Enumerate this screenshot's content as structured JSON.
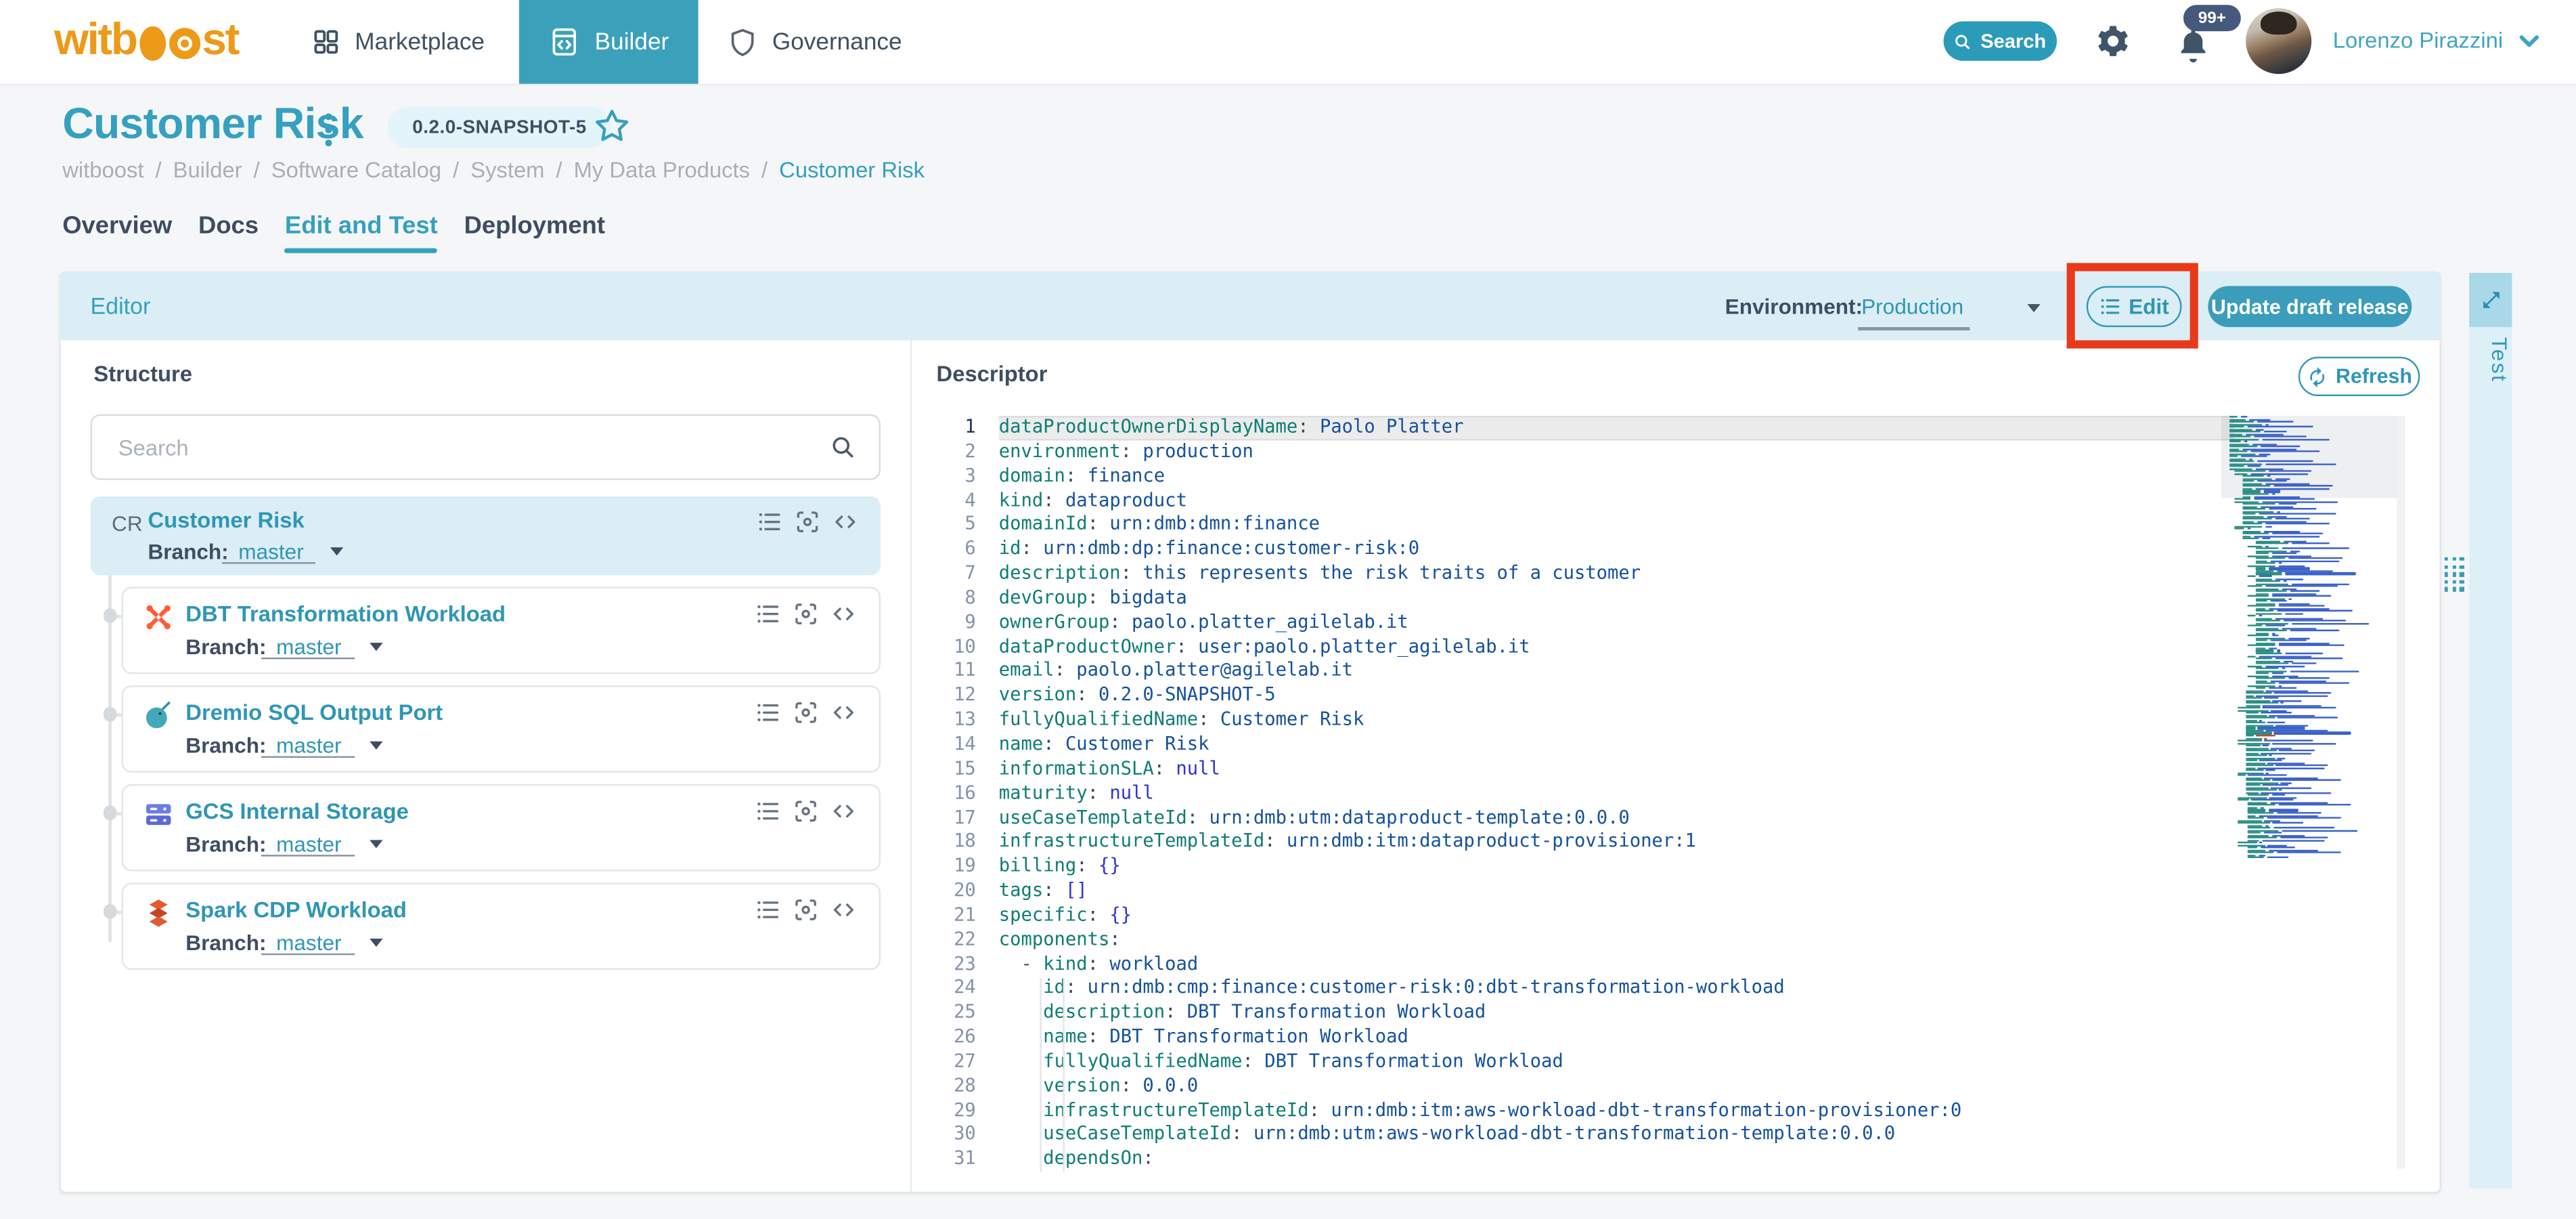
{
  "nav": {
    "logo_word_start": "witb",
    "logo_word_end": "st",
    "items": [
      {
        "label": "Marketplace"
      },
      {
        "label": "Builder"
      },
      {
        "label": "Governance"
      }
    ],
    "active_item": "Builder",
    "search_label": "Search",
    "notifications_badge": "99+",
    "user_name": "Lorenzo Pirazzini"
  },
  "page": {
    "title": "Customer Risk",
    "version_badge": "0.2.0-SNAPSHOT-5",
    "breadcrumb": [
      "witboost",
      "Builder",
      "Software Catalog",
      "System",
      "My Data Products",
      "Customer Risk"
    ],
    "tabs": [
      "Overview",
      "Docs",
      "Edit and Test",
      "Deployment"
    ],
    "active_tab": "Edit and Test"
  },
  "editor": {
    "title": "Editor",
    "environment_label": "Environment:",
    "environment_value": "Production",
    "edit_button": "Edit",
    "update_button": "Update draft release",
    "test_tab": "Test"
  },
  "structure": {
    "title": "Structure",
    "search_placeholder": "Search",
    "branch_label": "Branch:",
    "root": {
      "initials": "CR",
      "name": "Customer Risk",
      "branch": "master"
    },
    "components": [
      {
        "icon": "dbt-logo",
        "name": "DBT Transformation Workload",
        "branch": "master"
      },
      {
        "icon": "dremio-logo",
        "name": "Dremio SQL Output Port",
        "branch": "master"
      },
      {
        "icon": "gcs-logo",
        "name": "GCS Internal Storage",
        "branch": "master"
      },
      {
        "icon": "spark-logo",
        "name": "Spark CDP Workload",
        "branch": "master"
      }
    ]
  },
  "descriptor": {
    "title": "Descriptor",
    "refresh_button": "Refresh",
    "yaml_lines": [
      {
        "n": 1,
        "i": 0,
        "k": "dataProductOwnerDisplayName",
        "v": "Paolo Platter"
      },
      {
        "n": 2,
        "i": 0,
        "k": "environment",
        "v": "production"
      },
      {
        "n": 3,
        "i": 0,
        "k": "domain",
        "v": "finance"
      },
      {
        "n": 4,
        "i": 0,
        "k": "kind",
        "v": "dataproduct"
      },
      {
        "n": 5,
        "i": 0,
        "k": "domainId",
        "v": "urn:dmb:dmn:finance"
      },
      {
        "n": 6,
        "i": 0,
        "k": "id",
        "v": "urn:dmb:dp:finance:customer-risk:0"
      },
      {
        "n": 7,
        "i": 0,
        "k": "description",
        "v": "this represents the risk traits of a customer"
      },
      {
        "n": 8,
        "i": 0,
        "k": "devGroup",
        "v": "bigdata"
      },
      {
        "n": 9,
        "i": 0,
        "k": "ownerGroup",
        "v": "paolo.platter_agilelab.it"
      },
      {
        "n": 10,
        "i": 0,
        "k": "dataProductOwner",
        "v": "user:paolo.platter_agilelab.it"
      },
      {
        "n": 11,
        "i": 0,
        "k": "email",
        "v": "paolo.platter@agilelab.it"
      },
      {
        "n": 12,
        "i": 0,
        "k": "version",
        "v": "0.2.0-SNAPSHOT-5"
      },
      {
        "n": 13,
        "i": 0,
        "k": "fullyQualifiedName",
        "v": "Customer Risk"
      },
      {
        "n": 14,
        "i": 0,
        "k": "name",
        "v": "Customer Risk"
      },
      {
        "n": 15,
        "i": 0,
        "k": "informationSLA",
        "v": "null",
        "t": "special"
      },
      {
        "n": 16,
        "i": 0,
        "k": "maturity",
        "v": "null",
        "t": "special"
      },
      {
        "n": 17,
        "i": 0,
        "k": "useCaseTemplateId",
        "v": "urn:dmb:utm:dataproduct-template:0.0.0"
      },
      {
        "n": 18,
        "i": 0,
        "k": "infrastructureTemplateId",
        "v": "urn:dmb:itm:dataproduct-provisioner:1"
      },
      {
        "n": 19,
        "i": 0,
        "k": "billing",
        "v": "{}",
        "t": "special"
      },
      {
        "n": 20,
        "i": 0,
        "k": "tags",
        "v": "[]",
        "t": "special"
      },
      {
        "n": 21,
        "i": 0,
        "k": "specific",
        "v": "{}",
        "t": "special"
      },
      {
        "n": 22,
        "i": 0,
        "k": "components",
        "v": ""
      },
      {
        "n": 23,
        "i": 2,
        "d": true,
        "k": "kind",
        "v": "workload"
      },
      {
        "n": 24,
        "i": 4,
        "k": "id",
        "v": "urn:dmb:cmp:finance:customer-risk:0:dbt-transformation-workload"
      },
      {
        "n": 25,
        "i": 4,
        "k": "description",
        "v": "DBT Transformation Workload"
      },
      {
        "n": 26,
        "i": 4,
        "k": "name",
        "v": "DBT Transformation Workload"
      },
      {
        "n": 27,
        "i": 4,
        "k": "fullyQualifiedName",
        "v": "DBT Transformation Workload"
      },
      {
        "n": 28,
        "i": 4,
        "k": "version",
        "v": "0.0.0"
      },
      {
        "n": 29,
        "i": 4,
        "k": "infrastructureTemplateId",
        "v": "urn:dmb:itm:aws-workload-dbt-transformation-provisioner:0"
      },
      {
        "n": 30,
        "i": 4,
        "k": "useCaseTemplateId",
        "v": "urn:dmb:utm:aws-workload-dbt-transformation-template:0.0.0"
      },
      {
        "n": 31,
        "i": 4,
        "k": "dependsOn",
        "v": ""
      }
    ]
  },
  "colors": {
    "accent": "#3598B8",
    "nav_active": "#3BA1BA",
    "logo_orange": "#ED9A19",
    "annotation_red": "#E8391B",
    "header_bar": "#DBEDF5",
    "yaml_key": "#0E7D74",
    "yaml_value": "#15519C",
    "yaml_special": "#2E31D8"
  }
}
